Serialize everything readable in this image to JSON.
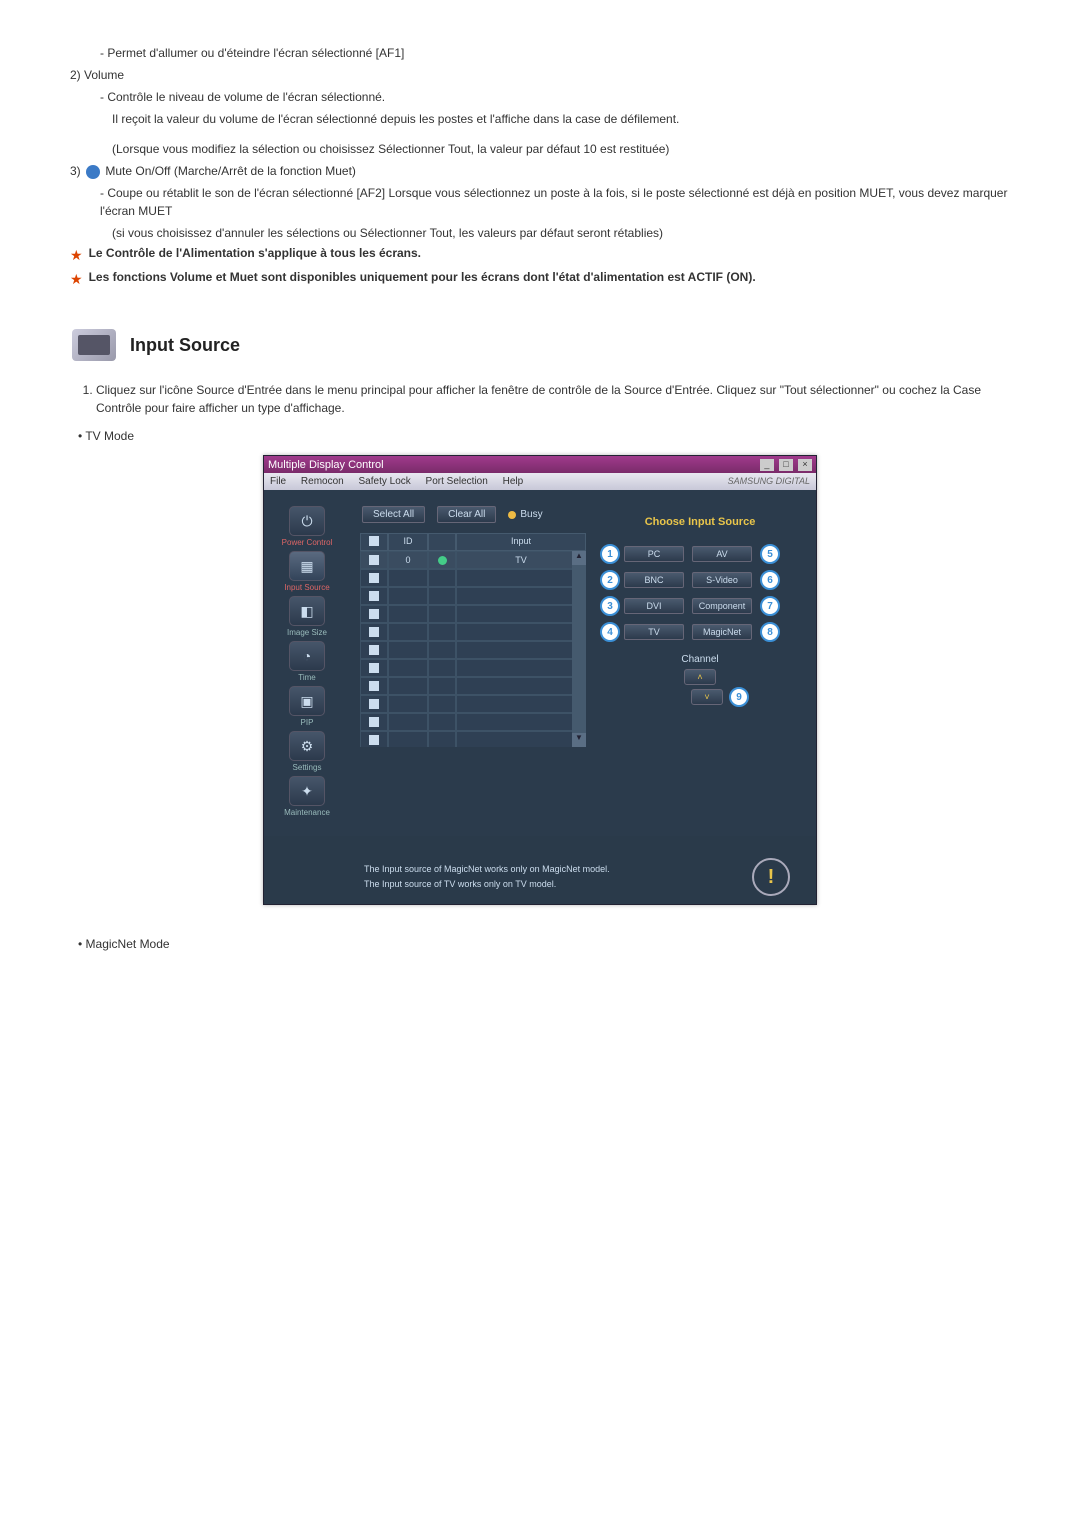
{
  "doc": {
    "line1": "- Permet d'allumer ou d'éteindre l'écran sélectionné [AF1]",
    "l2_num": "2)",
    "l2_title": "Volume",
    "l2a": "- Contrôle le niveau de volume de l'écran sélectionné.",
    "l2b": "Il reçoit la valeur du volume de l'écran sélectionné depuis les postes et l'affiche dans la case de défilement.",
    "l2c": "(Lorsque vous modifiez la sélection ou choisissez Sélectionner Tout, la valeur par défaut 10 est restituée)",
    "l3_num": "3)",
    "l3_title": "Mute On/Off (Marche/Arrêt de la fonction Muet)",
    "l3a": "- Coupe ou rétablit le son de l'écran sélectionné [AF2] Lorsque vous sélectionnez un poste à la fois, si le poste sélectionné est déjà en position MUET, vous devez marquer l'écran MUET",
    "l3b": "(si vous choisissez d'annuler les sélections ou Sélectionner Tout, les valeurs par défaut seront rétablies)",
    "star1": "Le Contrôle de l'Alimentation s'applique à tous les écrans.",
    "star2": "Les fonctions Volume et Muet sont disponibles uniquement pour les écrans dont l'état d'alimentation est ACTIF (ON).",
    "section_title": "Input Source",
    "inst1": "Cliquez sur l'icône Source d'Entrée dans le menu principal pour afficher la fenêtre de contrôle de la Source d'Entrée. Cliquez sur \"Tout sélectionner\" ou cochez la Case Contrôle pour faire afficher un type d'affichage.",
    "bullet_tv": "TV Mode",
    "bullet_magic": "MagicNet Mode"
  },
  "app": {
    "title": "Multiple Display Control",
    "menus": [
      "File",
      "Remocon",
      "Safety Lock",
      "Port Selection",
      "Help"
    ],
    "brand": "SAMSUNG DIGITAL",
    "toolbar": {
      "select_all": "Select All",
      "clear_all": "Clear All",
      "busy": "Busy"
    },
    "grid": {
      "col_id": "ID",
      "col_input": "Input",
      "row0_id": "0",
      "row0_input": "TV"
    },
    "sidebar": [
      {
        "label": "Power Control"
      },
      {
        "label": "Input Source"
      },
      {
        "label": "Image Size"
      },
      {
        "label": "Time"
      },
      {
        "label": "PIP"
      },
      {
        "label": "Settings"
      },
      {
        "label": "Maintenance"
      }
    ],
    "panel": {
      "title": "Choose Input Source",
      "btns_left": [
        "PC",
        "BNC",
        "DVI",
        "TV"
      ],
      "btns_right": [
        "AV",
        "S-Video",
        "Component",
        "MagicNet"
      ],
      "nums_left": [
        "1",
        "2",
        "3",
        "4"
      ],
      "nums_right": [
        "5",
        "6",
        "7",
        "8"
      ],
      "channel_label": "Channel",
      "nine": "9"
    },
    "footer": {
      "l1": "The Input source of MagicNet works only on MagicNet model.",
      "l2": "The Input source of TV works only on TV model."
    }
  }
}
